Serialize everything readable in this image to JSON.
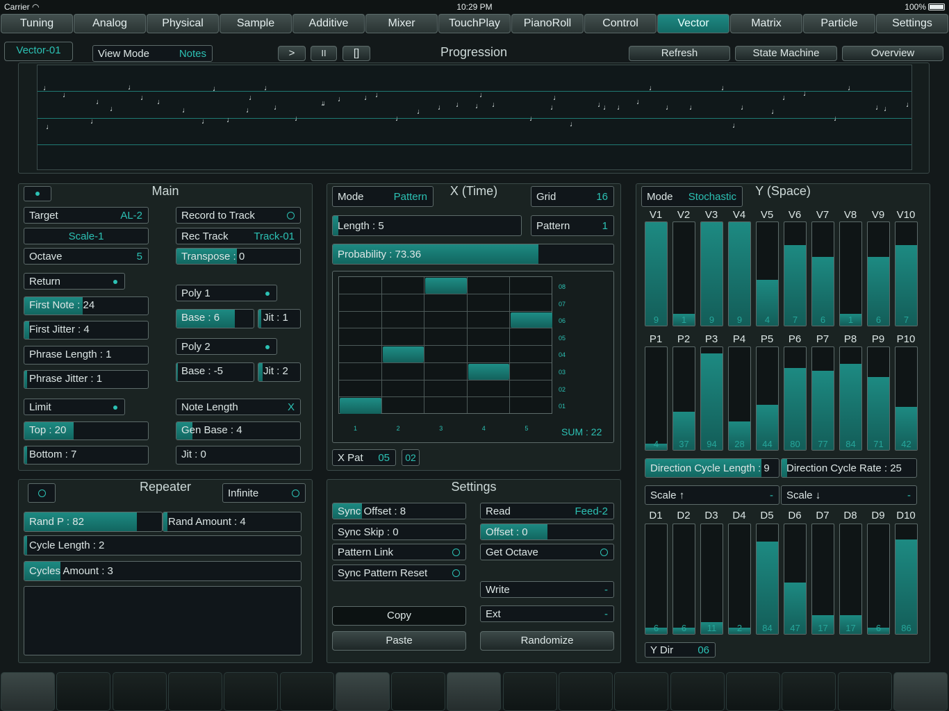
{
  "status": {
    "carrier": "Carrier",
    "time": "10:29 PM",
    "battery": "100%"
  },
  "tabs": [
    "Tuning",
    "Analog",
    "Physical",
    "Sample",
    "Additive",
    "Mixer",
    "TouchPlay",
    "PianoRoll",
    "Control",
    "Vector",
    "Matrix",
    "Particle",
    "Settings"
  ],
  "active_tab": "Vector",
  "topbar": {
    "preset": "Vector-01",
    "view_mode_label": "View Mode",
    "view_mode_value": "Notes",
    "play": ">",
    "pause": "II",
    "stop": "[]",
    "title": "Progression",
    "refresh": "Refresh",
    "state_machine": "State Machine",
    "overview": "Overview"
  },
  "main": {
    "title": "Main",
    "target_label": "Target",
    "target_value": "AL-2",
    "scale": "Scale-1",
    "octave_label": "Octave",
    "octave_value": "5",
    "return": "Return",
    "first_note": "First Note : 24",
    "first_jitter": "First Jitter : 4",
    "phrase_length": "Phrase Length : 1",
    "phrase_jitter": "Phrase Jitter : 1",
    "limit": "Limit",
    "top": "Top : 20",
    "bottom": "Bottom : 7",
    "record_to_track": "Record to Track",
    "rec_track_label": "Rec Track",
    "rec_track_value": "Track-01",
    "transpose": "Transpose : 0",
    "poly1": "Poly 1",
    "base1": "Base : 6",
    "jit1": "Jit : 1",
    "poly2": "Poly 2",
    "base2": "Base : -5",
    "jit2": "Jit : 2",
    "note_length_label": "Note Length",
    "note_length_value": "X",
    "gen_base": "Gen Base : 4",
    "jit0": "Jit : 0"
  },
  "repeater": {
    "title": "Repeater",
    "infinite": "Infinite",
    "rand_p": "Rand P : 82",
    "rand_amount": "Rand Amount : 4",
    "cycle_length": "Cycle Length : 2",
    "cycles_amount": "Cycles Amount : 3"
  },
  "xtime": {
    "title": "X (Time)",
    "mode_label": "Mode",
    "mode_value": "Pattern",
    "grid_label": "Grid",
    "grid_value": "16",
    "length": "Length : 5",
    "pattern_label": "Pattern",
    "pattern_value": "1",
    "probability": "Probability : 73.36",
    "y_ticks": [
      "08",
      "07",
      "06",
      "05",
      "04",
      "03",
      "02",
      "01"
    ],
    "x_ticks": [
      "1",
      "2",
      "3",
      "4",
      "5"
    ],
    "sum": "SUM : 22",
    "xpat_label": "X Pat",
    "xpat_value": "05",
    "xpat_value2": "02",
    "steps": [
      {
        "step": 1,
        "value": 1
      },
      {
        "step": 2,
        "value": 4
      },
      {
        "step": 3,
        "value": 8
      },
      {
        "step": 4,
        "value": 3
      },
      {
        "step": 5,
        "value": 6
      }
    ]
  },
  "settings": {
    "title": "Settings",
    "sync_offset": "Sync Offset : 8",
    "sync_skip": "Sync Skip : 0",
    "pattern_link": "Pattern Link",
    "sync_pattern_reset": "Sync Pattern Reset",
    "read_label": "Read",
    "read_value": "Feed-2",
    "offset": "Offset : 0",
    "get_octave": "Get Octave",
    "write_label": "Write",
    "write_value": "-",
    "ext_label": "Ext",
    "ext_value": "-",
    "copy": "Copy",
    "paste": "Paste",
    "randomize": "Randomize"
  },
  "yspace": {
    "title": "Y (Space)",
    "mode_label": "Mode",
    "mode_value": "Stochastic",
    "v": [
      {
        "n": "V1",
        "v": "9"
      },
      {
        "n": "V2",
        "v": "1"
      },
      {
        "n": "V3",
        "v": "9"
      },
      {
        "n": "V4",
        "v": "9"
      },
      {
        "n": "V5",
        "v": "4"
      },
      {
        "n": "V6",
        "v": "7"
      },
      {
        "n": "V7",
        "v": "6"
      },
      {
        "n": "V8",
        "v": "1"
      },
      {
        "n": "V9",
        "v": "6"
      },
      {
        "n": "V10",
        "v": "7"
      }
    ],
    "p": [
      {
        "n": "P1",
        "v": "4"
      },
      {
        "n": "P2",
        "v": "37"
      },
      {
        "n": "P3",
        "v": "94"
      },
      {
        "n": "P4",
        "v": "28"
      },
      {
        "n": "P5",
        "v": "44"
      },
      {
        "n": "P6",
        "v": "80"
      },
      {
        "n": "P7",
        "v": "77"
      },
      {
        "n": "P8",
        "v": "84"
      },
      {
        "n": "P9",
        "v": "71"
      },
      {
        "n": "P10",
        "v": "42"
      }
    ],
    "d": [
      {
        "n": "D1",
        "v": "6"
      },
      {
        "n": "D2",
        "v": "6"
      },
      {
        "n": "D3",
        "v": "11"
      },
      {
        "n": "D4",
        "v": "2"
      },
      {
        "n": "D5",
        "v": "84"
      },
      {
        "n": "D6",
        "v": "47"
      },
      {
        "n": "D7",
        "v": "17"
      },
      {
        "n": "D8",
        "v": "17"
      },
      {
        "n": "D9",
        "v": "6"
      },
      {
        "n": "D10",
        "v": "86"
      }
    ],
    "dir_cycle_length": "Direction Cycle Length : 9",
    "dir_cycle_rate": "Direction Cycle Rate : 25",
    "scale_up": "Scale ↑",
    "scale_up_val": "-",
    "scale_down": "Scale ↓",
    "scale_down_val": "-",
    "ydir_label": "Y Dir",
    "ydir_value": "06"
  },
  "colors": {
    "accent": "#1d8a82",
    "text_accent": "#2cc1b4",
    "bg": "#13191a"
  }
}
